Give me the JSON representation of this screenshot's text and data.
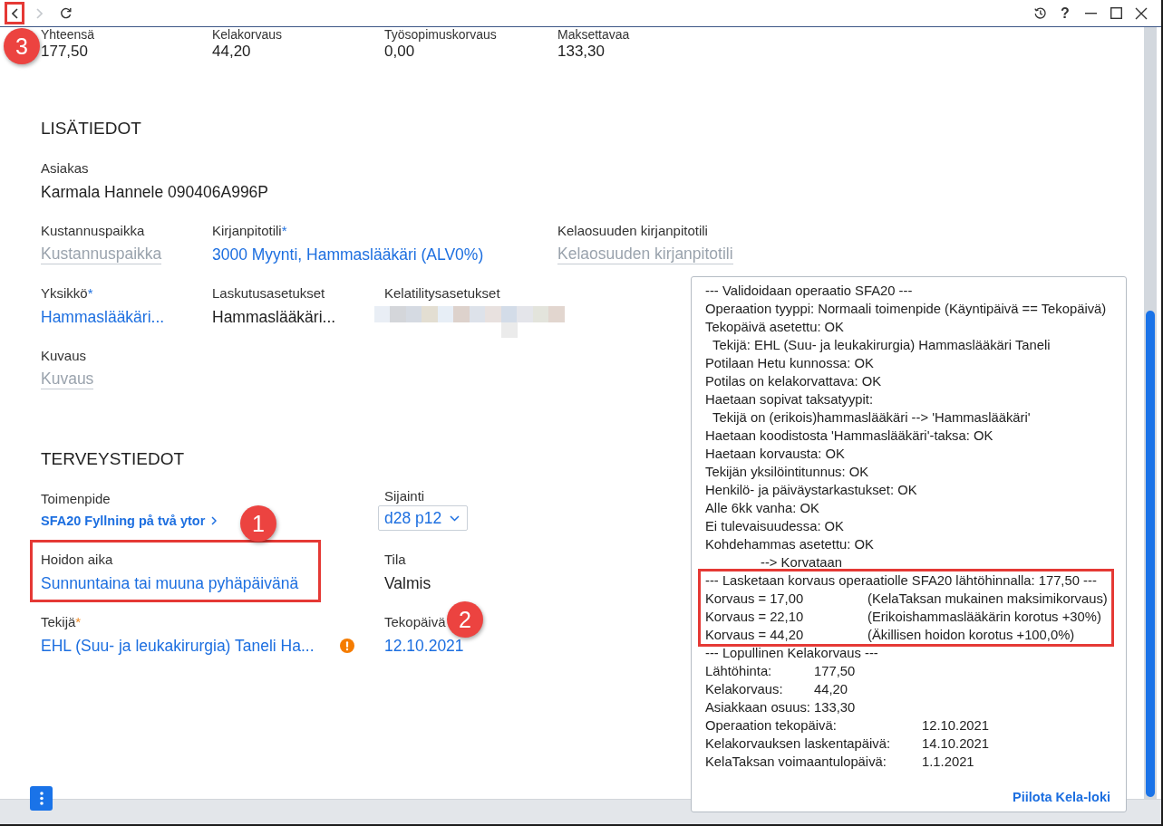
{
  "toolbar": {
    "nav_buttons": [
      {
        "kind": "back",
        "disabled": false,
        "highlighted": true
      },
      {
        "kind": "forward",
        "disabled": true,
        "highlighted": false
      }
    ],
    "help_label": "?"
  },
  "summary": [
    {
      "label": "Yhteensä",
      "value": "177,50"
    },
    {
      "label": "Kelakorvaus",
      "value": "44,20"
    },
    {
      "label": "Työsopimuskorvaus",
      "value": "0,00"
    },
    {
      "label": "Maksettavaa",
      "value": "133,30"
    }
  ],
  "sections": [
    {
      "title": "LISÄTIEDOT",
      "fields": [
        {
          "kind": "text",
          "label": "Asiakas",
          "value": "Karmala Hannele 090406A996P",
          "highlighted": false,
          "warning": false
        },
        {
          "kind": "empty",
          "label": "Kustannuspaikka",
          "placeholder": "Kustannuspaikka",
          "highlighted": false,
          "warning": false
        },
        {
          "kind": "link",
          "label": "Kirjanpitotili",
          "required_mark": "*",
          "value": "3000 Myynti, Hammaslääkäri (ALV0%)",
          "highlighted": false,
          "warning": false
        },
        {
          "kind": "empty",
          "label": "Kelaosuuden kirjanpitotili",
          "placeholder": "Kelaosuuden kirjanpitotili",
          "highlighted": false,
          "warning": false
        },
        {
          "kind": "link",
          "label": "Yksikkö",
          "required_mark": "*",
          "value": "Hammaslääkäri...",
          "highlighted": false,
          "warning": false
        },
        {
          "kind": "text",
          "label": "Laskutusasetukset",
          "value": "Hammaslääkäri...",
          "highlighted": false,
          "warning": false
        },
        {
          "kind": "redacted",
          "label": "Kelatilitysasetukset",
          "highlighted": false,
          "warning": false
        },
        {
          "kind": "empty",
          "label": "Kuvaus",
          "placeholder": "Kuvaus",
          "highlighted": false,
          "warning": false
        }
      ]
    },
    {
      "title": "TERVEYSTIEDOT",
      "fields": [
        {
          "kind": "nav",
          "label": "Toimenpide",
          "value": "SFA20 Fyllning på två ytor",
          "highlighted": false,
          "warning": false
        },
        {
          "kind": "dropdown",
          "label": "Sijainti",
          "value": "d28 p12",
          "highlighted": false,
          "warning": false
        },
        {
          "kind": "link",
          "label": "Hoidon aika",
          "value": "Sunnuntaina tai muuna pyhäpäivänä",
          "highlighted": true,
          "warning": false
        },
        {
          "kind": "text",
          "label": "Tila",
          "value": "Valmis",
          "highlighted": false,
          "warning": false
        },
        {
          "kind": "link",
          "label": "Tekijä",
          "required_mark": "*",
          "value": "EHL (Suu- ja leukakirurgia) Taneli Ha...",
          "highlighted": false,
          "warning": true
        },
        {
          "kind": "link",
          "label": "Tekopäivä",
          "value": "12.10.2021",
          "highlighted": false,
          "warning": false
        }
      ]
    }
  ],
  "kela_log": {
    "blocks": [
      {
        "highlighted": false,
        "lines": [
          {
            "kind": "text",
            "text": "--- Validoidaan operaatio SFA20 ---"
          },
          {
            "kind": "text",
            "text": "Operaation tyyppi: Normaali toimenpide (Käyntipäivä == Tekopäivä)"
          },
          {
            "kind": "text",
            "text": "Tekopäivä asetettu: OK"
          },
          {
            "kind": "indent",
            "text": "Tekijä: EHL (Suu- ja leukakirurgia) Hammaslääkäri Taneli"
          },
          {
            "kind": "text",
            "text": "Potilaan Hetu kunnossa: OK"
          },
          {
            "kind": "text",
            "text": "Potilas on kelakorvattava: OK"
          },
          {
            "kind": "text",
            "text": "Haetaan sopivat taksatyypit:"
          },
          {
            "kind": "indent",
            "text": "Tekijä on (erikois)hammaslääkäri --> 'Hammaslääkäri'"
          },
          {
            "kind": "text",
            "text": "Haetaan koodistosta 'Hammaslääkäri'-taksa: OK"
          },
          {
            "kind": "text",
            "text": "Haetaan korvausta: OK"
          },
          {
            "kind": "text",
            "text": "Tekijän yksilöintitunnus: OK"
          },
          {
            "kind": "text",
            "text": "Henkilö- ja päiväystarkastukset: OK"
          },
          {
            "kind": "text",
            "text": "Alle 6kk vanha: OK"
          },
          {
            "kind": "text",
            "text": "Ei tulevaisuudessa: OK"
          },
          {
            "kind": "text",
            "text": "Kohdehammas asetettu: OK"
          },
          {
            "kind": "result",
            "text": "--> Korvataan"
          }
        ]
      },
      {
        "highlighted": true,
        "lines": [
          {
            "kind": "text",
            "text": "--- Lasketaan korvaus operaatiolle SFA20 lähtöhinnalla: 177,50 ---"
          },
          {
            "kind": "korvaus",
            "text": "Korvaus = 17,00",
            "value": "(KelaTaksan mukainen maksimikorvaus)"
          },
          {
            "kind": "korvaus",
            "text": "Korvaus = 22,10",
            "value": "(Erikoishammaslääkärin korotus +30%)"
          },
          {
            "kind": "korvaus",
            "text": "Korvaus = 44,20",
            "value": "(Äkillisen hoidon korotus +100,0%)"
          }
        ]
      },
      {
        "highlighted": false,
        "lines": [
          {
            "kind": "text",
            "text": "--- Lopullinen Kelakorvaus ---"
          },
          {
            "kind": "amount",
            "text": "Lähtöhinta:",
            "value": "177,50"
          },
          {
            "kind": "amount",
            "text": "Kelakorvaus:",
            "value": "44,20"
          },
          {
            "kind": "amount",
            "text": "Asiakkaan osuus:",
            "value": "133,30"
          },
          {
            "kind": "date",
            "text": "Operaation tekopäivä:",
            "value": "12.10.2021"
          },
          {
            "kind": "date",
            "text": "Kelakorvauksen laskentapäivä:",
            "value": "14.10.2021"
          },
          {
            "kind": "date",
            "text": "KelaTaksan voimaantulopäivä:",
            "value": "1.1.2021"
          }
        ]
      }
    ],
    "hide_link": "Piilota Kela-loki"
  },
  "annotation_badges": [
    "1",
    "2",
    "3"
  ]
}
